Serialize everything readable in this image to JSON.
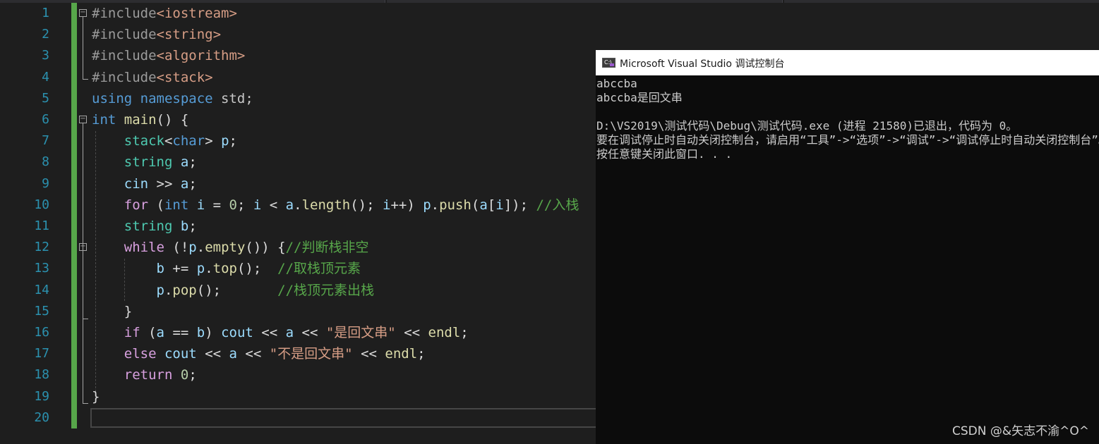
{
  "editor": {
    "line_numbers": [
      "1",
      "2",
      "3",
      "4",
      "5",
      "6",
      "7",
      "8",
      "9",
      "10",
      "11",
      "12",
      "13",
      "14",
      "15",
      "16",
      "17",
      "18",
      "19",
      "20"
    ],
    "lines": [
      [
        {
          "t": "#include",
          "c": "pp"
        },
        {
          "t": "<iostream>",
          "c": "inc"
        }
      ],
      [
        {
          "t": "#include",
          "c": "pp"
        },
        {
          "t": "<string>",
          "c": "inc"
        }
      ],
      [
        {
          "t": "#include",
          "c": "pp"
        },
        {
          "t": "<algorithm>",
          "c": "inc"
        }
      ],
      [
        {
          "t": "#include",
          "c": "pp"
        },
        {
          "t": "<stack>",
          "c": "inc"
        }
      ],
      [
        {
          "t": "using",
          "c": "kw"
        },
        {
          "t": " "
        },
        {
          "t": "namespace",
          "c": "kw"
        },
        {
          "t": " std;",
          "c": "ns"
        }
      ],
      [
        {
          "t": "int",
          "c": "kw"
        },
        {
          "t": " "
        },
        {
          "t": "main",
          "c": "fn"
        },
        {
          "t": "() {"
        }
      ],
      [
        {
          "t": "    "
        },
        {
          "t": "stack",
          "c": "ty"
        },
        {
          "t": "<"
        },
        {
          "t": "char",
          "c": "kw"
        },
        {
          "t": "> "
        },
        {
          "t": "p",
          "c": "va"
        },
        {
          "t": ";"
        }
      ],
      [
        {
          "t": "    "
        },
        {
          "t": "string",
          "c": "ty"
        },
        {
          "t": " "
        },
        {
          "t": "a",
          "c": "va"
        },
        {
          "t": ";"
        }
      ],
      [
        {
          "t": "    "
        },
        {
          "t": "cin",
          "c": "va"
        },
        {
          "t": " >> "
        },
        {
          "t": "a",
          "c": "va"
        },
        {
          "t": ";"
        }
      ],
      [
        {
          "t": "    "
        },
        {
          "t": "for",
          "c": "ct"
        },
        {
          "t": " ("
        },
        {
          "t": "int",
          "c": "kw"
        },
        {
          "t": " "
        },
        {
          "t": "i",
          "c": "va"
        },
        {
          "t": " = "
        },
        {
          "t": "0",
          "c": "nu"
        },
        {
          "t": "; "
        },
        {
          "t": "i",
          "c": "va"
        },
        {
          "t": " < "
        },
        {
          "t": "a",
          "c": "va"
        },
        {
          "t": "."
        },
        {
          "t": "length",
          "c": "fn"
        },
        {
          "t": "(); "
        },
        {
          "t": "i",
          "c": "va"
        },
        {
          "t": "++) "
        },
        {
          "t": "p",
          "c": "va"
        },
        {
          "t": "."
        },
        {
          "t": "push",
          "c": "fn"
        },
        {
          "t": "("
        },
        {
          "t": "a",
          "c": "va"
        },
        {
          "t": "["
        },
        {
          "t": "i",
          "c": "va"
        },
        {
          "t": "]); "
        },
        {
          "t": "//入栈",
          "c": "cm"
        }
      ],
      [
        {
          "t": "    "
        },
        {
          "t": "string",
          "c": "ty"
        },
        {
          "t": " "
        },
        {
          "t": "b",
          "c": "va"
        },
        {
          "t": ";"
        }
      ],
      [
        {
          "t": "    "
        },
        {
          "t": "while",
          "c": "ct"
        },
        {
          "t": " (!"
        },
        {
          "t": "p",
          "c": "va"
        },
        {
          "t": "."
        },
        {
          "t": "empty",
          "c": "fn"
        },
        {
          "t": "()) {"
        },
        {
          "t": "//判断栈非空",
          "c": "cm"
        }
      ],
      [
        {
          "t": "        "
        },
        {
          "t": "b",
          "c": "va"
        },
        {
          "t": " += "
        },
        {
          "t": "p",
          "c": "va"
        },
        {
          "t": "."
        },
        {
          "t": "top",
          "c": "fn"
        },
        {
          "t": "();  "
        },
        {
          "t": "//取栈顶元素",
          "c": "cm"
        }
      ],
      [
        {
          "t": "        "
        },
        {
          "t": "p",
          "c": "va"
        },
        {
          "t": "."
        },
        {
          "t": "pop",
          "c": "fn"
        },
        {
          "t": "();       "
        },
        {
          "t": "//栈顶元素出栈",
          "c": "cm"
        }
      ],
      [
        {
          "t": "    }"
        }
      ],
      [
        {
          "t": "    "
        },
        {
          "t": "if",
          "c": "ct"
        },
        {
          "t": " ("
        },
        {
          "t": "a",
          "c": "va"
        },
        {
          "t": " == "
        },
        {
          "t": "b",
          "c": "va"
        },
        {
          "t": ") "
        },
        {
          "t": "cout",
          "c": "va"
        },
        {
          "t": " << "
        },
        {
          "t": "a",
          "c": "va"
        },
        {
          "t": " << "
        },
        {
          "t": "\"是回文串\"",
          "c": "st"
        },
        {
          "t": " << "
        },
        {
          "t": "endl",
          "c": "fn"
        },
        {
          "t": ";"
        }
      ],
      [
        {
          "t": "    "
        },
        {
          "t": "else",
          "c": "ct"
        },
        {
          "t": " "
        },
        {
          "t": "cout",
          "c": "va"
        },
        {
          "t": " << "
        },
        {
          "t": "a",
          "c": "va"
        },
        {
          "t": " << "
        },
        {
          "t": "\"不是回文串\"",
          "c": "st"
        },
        {
          "t": " << "
        },
        {
          "t": "endl",
          "c": "fn"
        },
        {
          "t": ";"
        }
      ],
      [
        {
          "t": "    "
        },
        {
          "t": "return",
          "c": "ct"
        },
        {
          "t": " "
        },
        {
          "t": "0",
          "c": "nu"
        },
        {
          "t": ";"
        }
      ],
      [
        {
          "t": "}"
        }
      ],
      [
        {
          "t": ""
        }
      ]
    ]
  },
  "console": {
    "title": "Microsoft Visual Studio 调试控制台",
    "icon": "console-app-icon",
    "lines": [
      "abccba",
      "abccba是回文串",
      "",
      "D:\\VS2019\\测试代码\\Debug\\测试代码.exe (进程 21580)已退出，代码为 0。",
      "要在调试停止时自动关闭控制台，请启用“工具”->“选项”->“调试”->“调试停止时自动关闭控制台”。",
      "按任意键关闭此窗口. . ."
    ]
  },
  "watermark": "CSDN @&矢志不渝^O^"
}
